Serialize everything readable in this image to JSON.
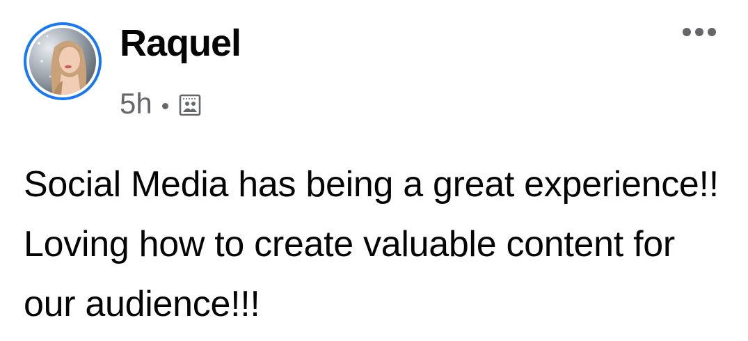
{
  "post": {
    "author": {
      "name": "Raquel"
    },
    "timestamp": "5h",
    "audience_icon": "photo-album-icon",
    "more_icon": "more-options-icon",
    "body": "Social Media has being a great experience!! Loving how to create valuable content for our audience!!!"
  },
  "colors": {
    "story_ring": "#1877f2",
    "text_primary": "#050505",
    "text_secondary": "#65676b"
  }
}
